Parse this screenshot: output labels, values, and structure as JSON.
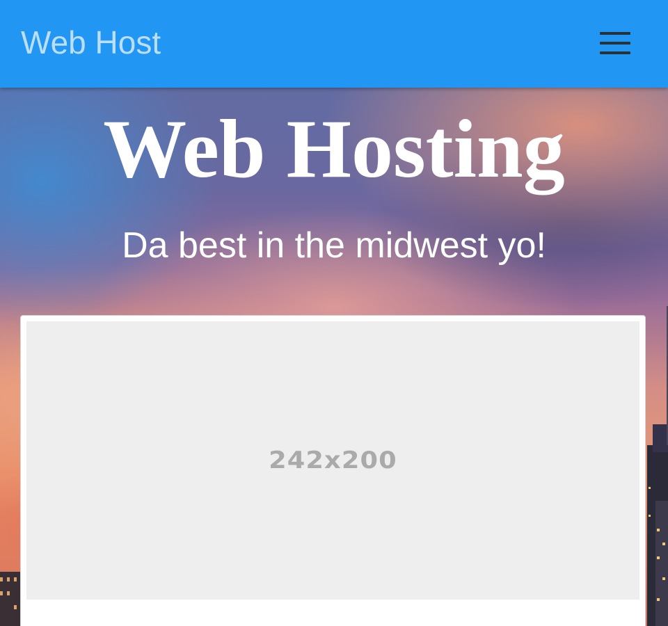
{
  "navbar": {
    "brand": "Web Host",
    "background_color": "#2196f3",
    "brand_color": "#bbdefb",
    "menu_icon": "hamburger-menu-icon"
  },
  "hero": {
    "title": "Web Hosting",
    "subtitle": "Da best in the midwest yo!"
  },
  "card": {
    "image_placeholder_label": "242x200"
  }
}
